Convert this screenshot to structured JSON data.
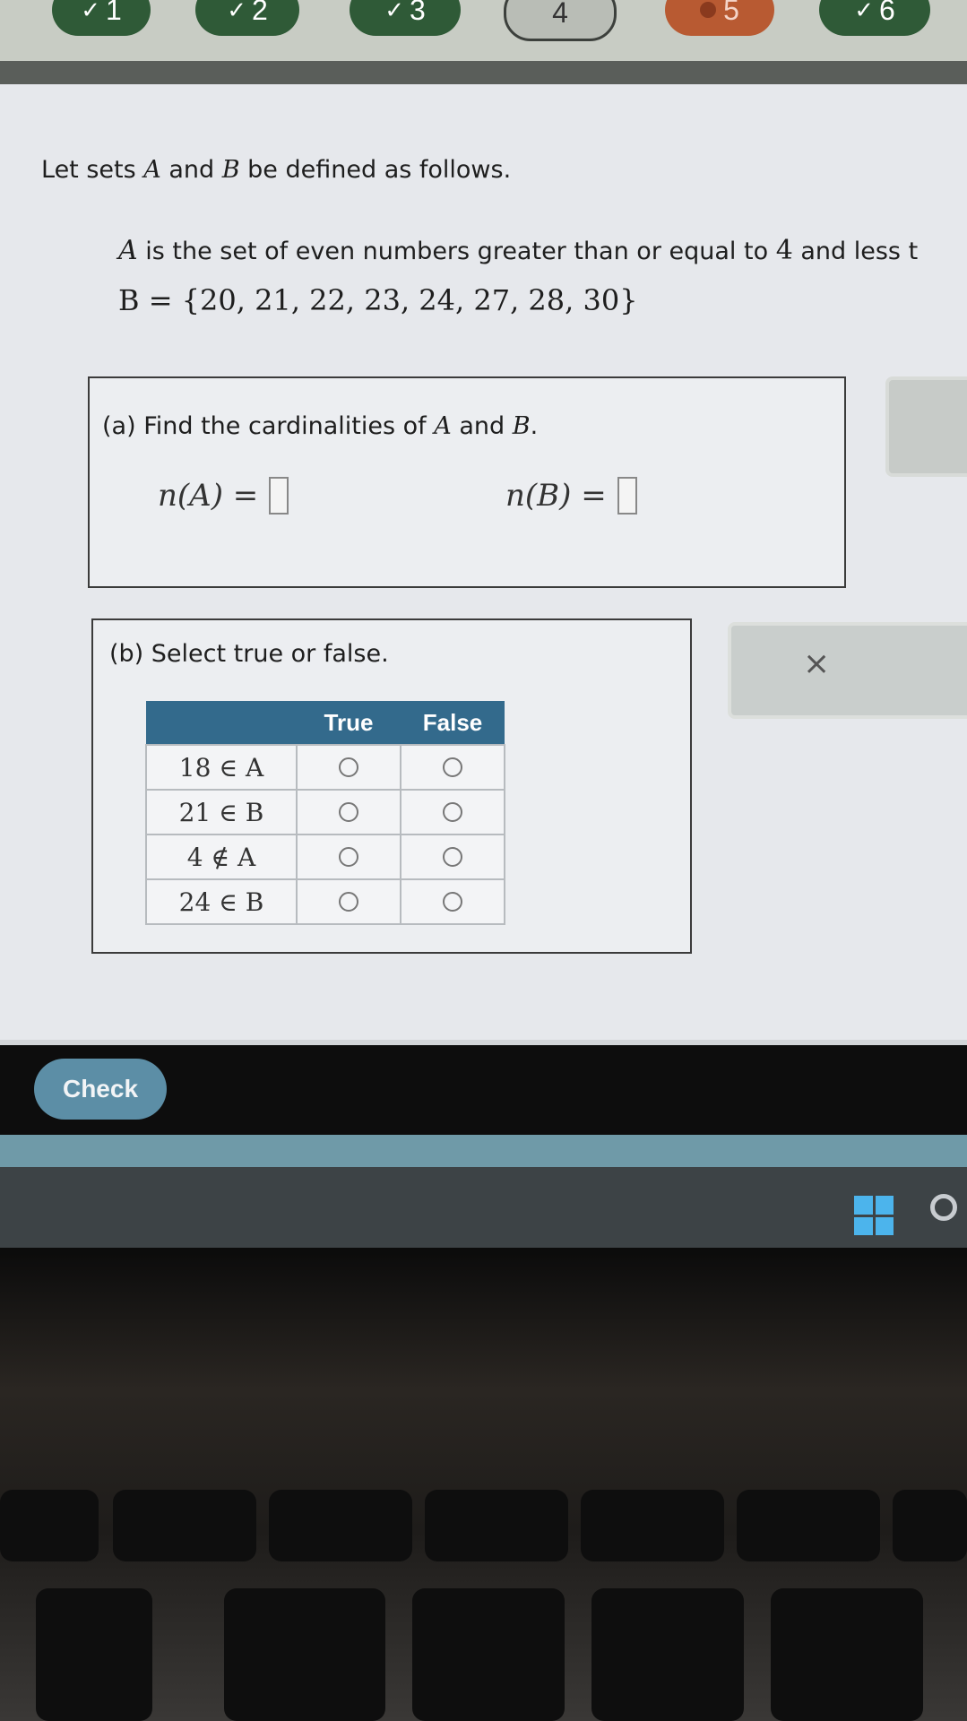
{
  "nav": {
    "questions": [
      {
        "label": "1",
        "status": "done"
      },
      {
        "label": "2",
        "status": "done"
      },
      {
        "label": "3",
        "status": "done"
      },
      {
        "label": "4",
        "status": "current"
      },
      {
        "label": "5",
        "status": "warning"
      },
      {
        "label": "6",
        "status": "done"
      }
    ]
  },
  "problem": {
    "intro_prefix": "Let sets ",
    "intro_A": "A",
    "intro_and": " and ",
    "intro_B": "B",
    "intro_suffix": " be defined as follows.",
    "a_var": "A",
    "a_desc_prefix": " is the set of even numbers greater than or equal to ",
    "a_desc_num": "4",
    "a_desc_suffix": " and less t",
    "b_def": "B = {20, 21, 22, 23, 24, 27, 28, 30}"
  },
  "part_a": {
    "label_prefix": "(a) Find the cardinalities of ",
    "A": "A",
    "and": " and ",
    "B": "B",
    "period": ".",
    "nA": "n(A) =",
    "nB": "n(B) ="
  },
  "part_b": {
    "label": "(b) Select true or false.",
    "headers": [
      "",
      "True",
      "False"
    ],
    "rows": [
      {
        "statement": "18 ∈ A"
      },
      {
        "statement": "21 ∈ B"
      },
      {
        "statement": "4 ∉ A"
      },
      {
        "statement": "24 ∈ B"
      }
    ]
  },
  "actions": {
    "check_label": "Check",
    "clear_symbol": "×"
  },
  "colors": {
    "table_header": "#336a8c",
    "check_button": "#5c8ea6",
    "done_pill": "#2f5a37",
    "warning_pill": "#b85a32"
  }
}
